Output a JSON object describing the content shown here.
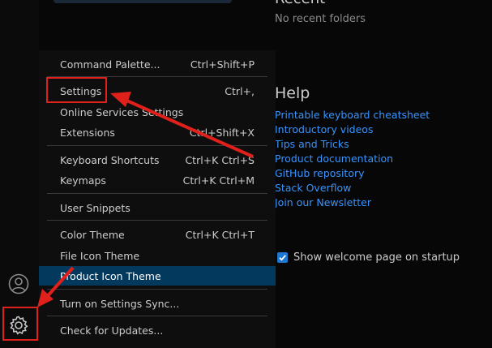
{
  "welcome": {
    "recent_title": "Recent",
    "recent_empty": "No recent folders",
    "help_title": "Help",
    "help_links": [
      "Printable keyboard cheatsheet",
      "Introductory videos",
      "Tips and Tricks",
      "Product documentation",
      "GitHub repository",
      "Stack Overflow",
      "Join our Newsletter"
    ],
    "startup_label": "Show welcome page on startup"
  },
  "menu": {
    "items": [
      {
        "label": "Command Palette...",
        "shortcut": "Ctrl+Shift+P"
      },
      {
        "label": "Settings",
        "shortcut": "Ctrl+,"
      },
      {
        "label": "Online Services Settings",
        "shortcut": ""
      },
      {
        "label": "Extensions",
        "shortcut": "Ctrl+Shift+X"
      },
      {
        "label": "Keyboard Shortcuts",
        "shortcut": "Ctrl+K Ctrl+S"
      },
      {
        "label": "Keymaps",
        "shortcut": "Ctrl+K Ctrl+M"
      },
      {
        "label": "User Snippets",
        "shortcut": ""
      },
      {
        "label": "Color Theme",
        "shortcut": "Ctrl+K Ctrl+T"
      },
      {
        "label": "File Icon Theme",
        "shortcut": ""
      },
      {
        "label": "Product Icon Theme",
        "shortcut": ""
      },
      {
        "label": "Turn on Settings Sync...",
        "shortcut": ""
      },
      {
        "label": "Check for Updates...",
        "shortcut": ""
      }
    ],
    "selected_item": "Product Icon Theme"
  },
  "activity_bar": {
    "icons": [
      "account-icon",
      "gear-icon"
    ]
  },
  "colors": {
    "accent": "#3794ff",
    "selection": "#04395e",
    "annotation": "#e0201a"
  }
}
